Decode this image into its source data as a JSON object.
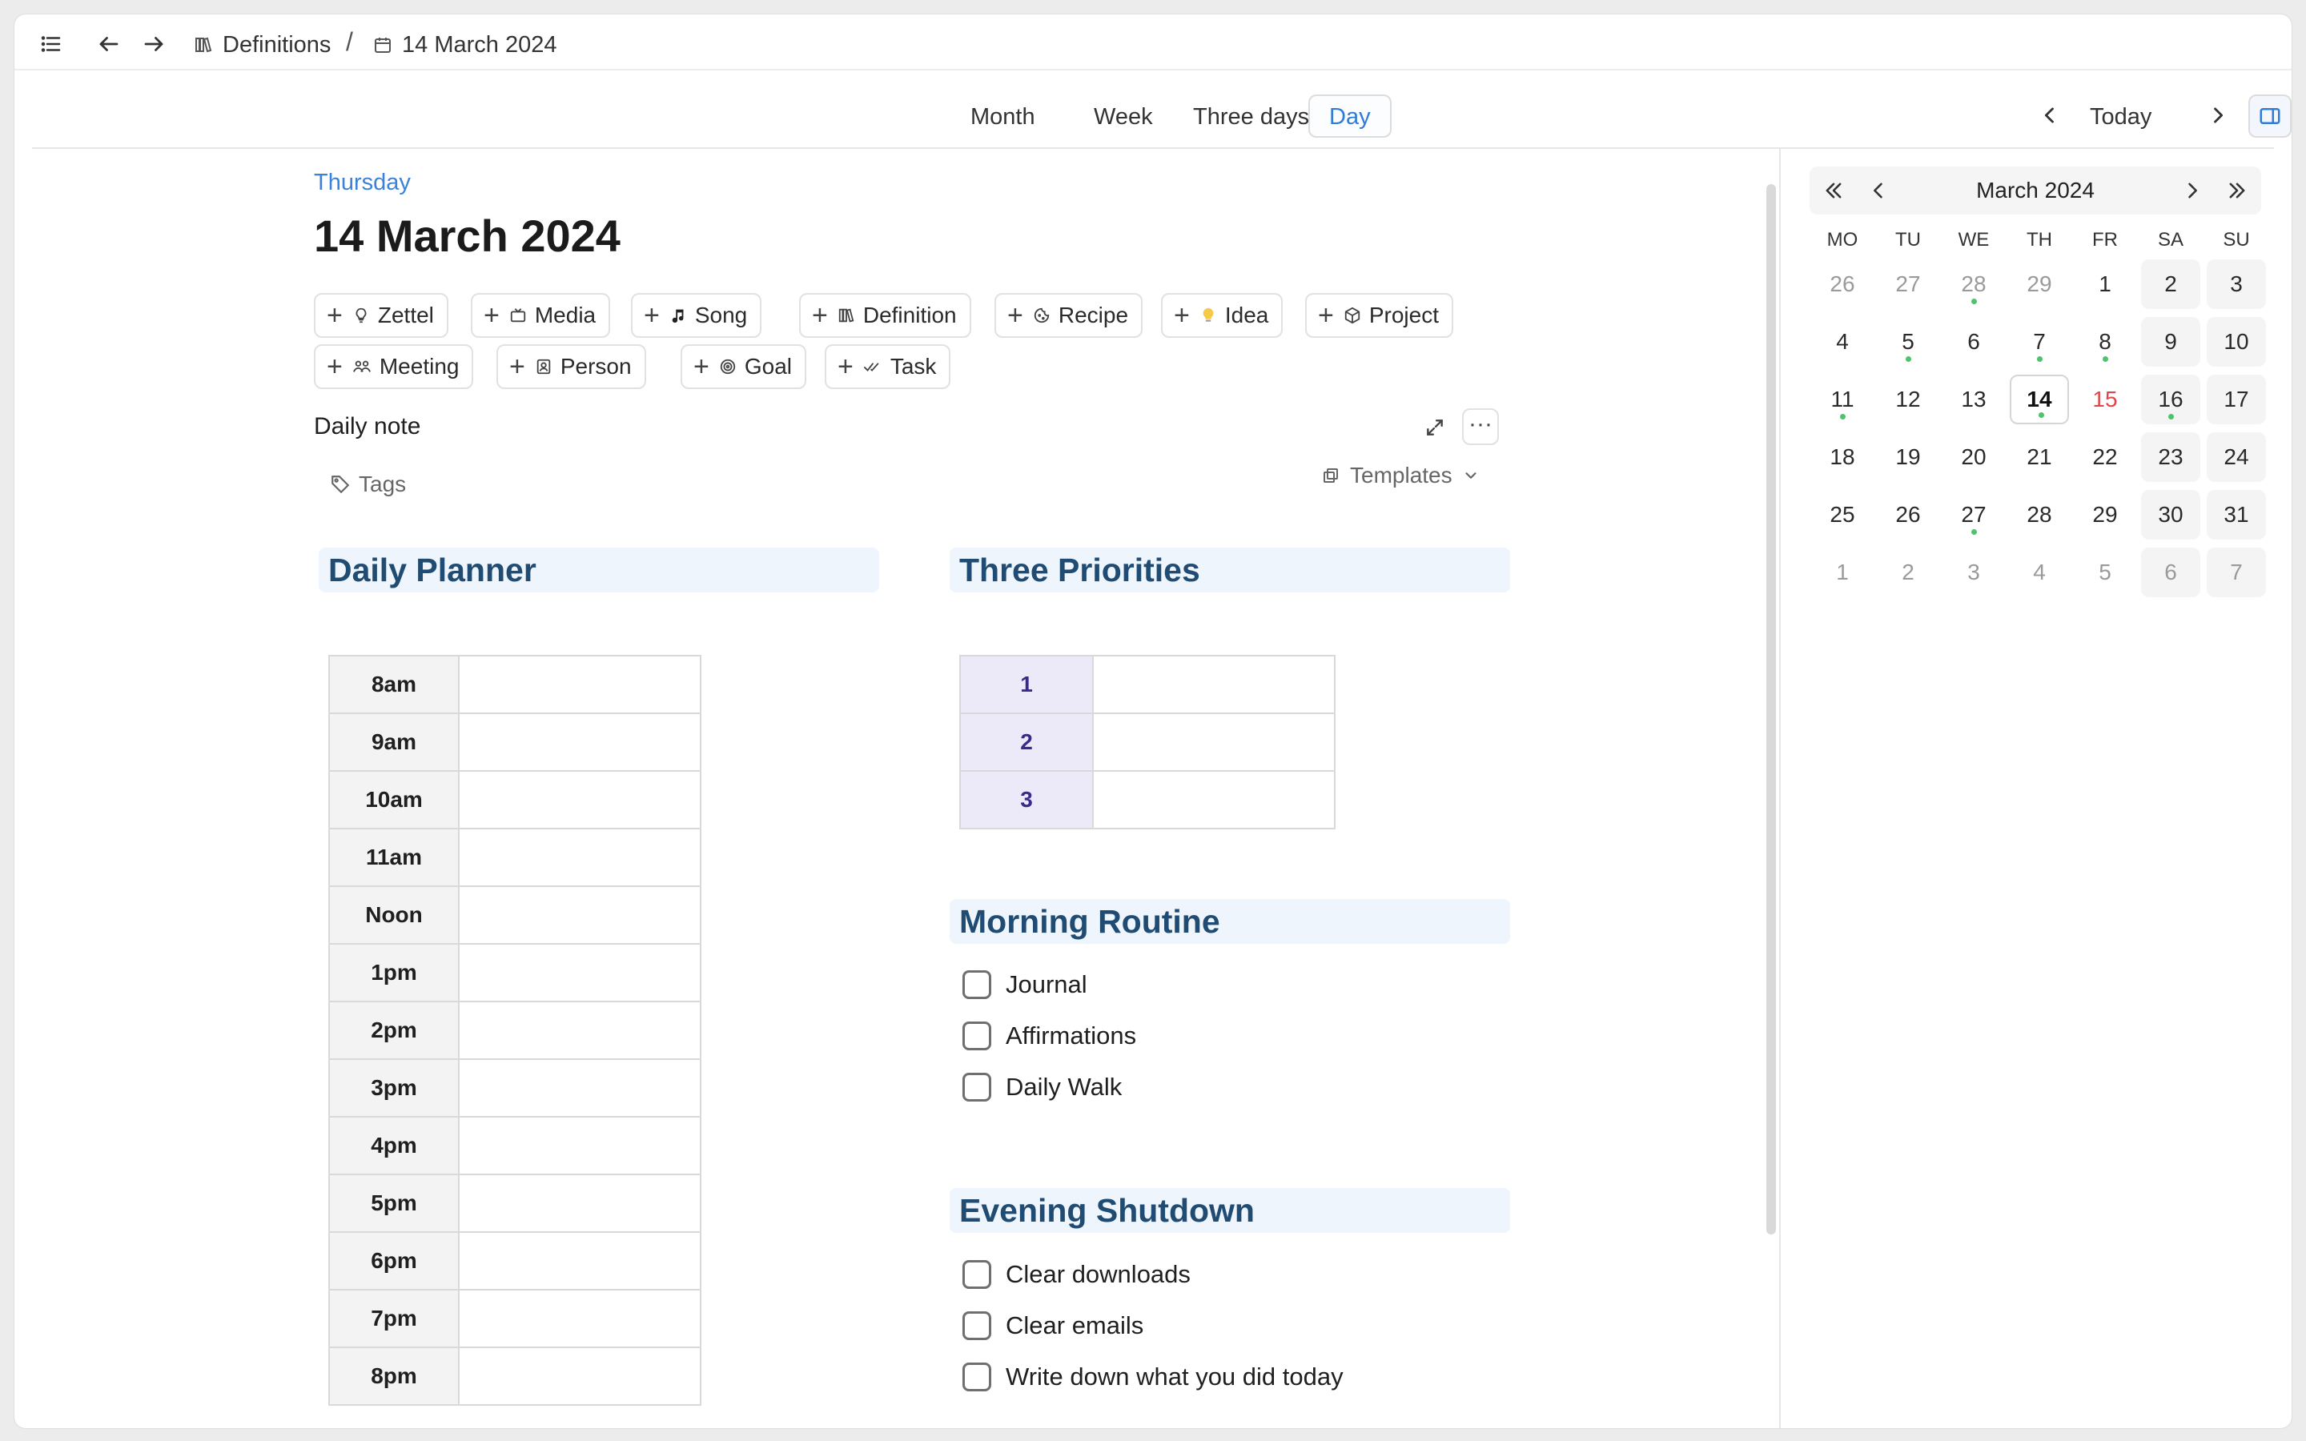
{
  "breadcrumb": {
    "parent": "Definitions",
    "separator": "/",
    "current": "14 March 2024"
  },
  "views": {
    "month": "Month",
    "week": "Week",
    "three_days": "Three days",
    "day": "Day",
    "today": "Today"
  },
  "note": {
    "weekday": "Thursday",
    "title": "14 March 2024"
  },
  "chips": [
    {
      "label": "Zettel",
      "icon": "lightbulb-icon"
    },
    {
      "label": "Media",
      "icon": "tv-icon"
    },
    {
      "label": "Song",
      "icon": "music-note-icon"
    },
    {
      "label": "Definition",
      "icon": "books-icon"
    },
    {
      "label": "Recipe",
      "icon": "cookie-icon"
    },
    {
      "label": "Idea",
      "icon": "bulb-emoji-icon"
    },
    {
      "label": "Project",
      "icon": "cube-icon"
    },
    {
      "label": "Meeting",
      "icon": "people-icon"
    },
    {
      "label": "Person",
      "icon": "contact-icon"
    },
    {
      "label": "Goal",
      "icon": "target-icon"
    },
    {
      "label": "Task",
      "icon": "checks-icon"
    }
  ],
  "daily_note": {
    "label": "Daily note",
    "more": "···",
    "tags": "Tags",
    "templates": "Templates"
  },
  "planner": {
    "title": "Daily Planner",
    "times": [
      "8am",
      "9am",
      "10am",
      "11am",
      "Noon",
      "1pm",
      "2pm",
      "3pm",
      "4pm",
      "5pm",
      "6pm",
      "7pm",
      "8pm"
    ]
  },
  "priorities": {
    "title": "Three Priorities",
    "items": [
      "1",
      "2",
      "3"
    ]
  },
  "morning": {
    "title": "Morning Routine",
    "items": [
      "Journal",
      "Affirmations",
      "Daily Walk"
    ]
  },
  "evening": {
    "title": "Evening Shutdown",
    "items": [
      "Clear downloads",
      "Clear emails",
      "Write down what you did today"
    ]
  },
  "calendar": {
    "month": "March 2024",
    "weekdays": [
      "MO",
      "TU",
      "WE",
      "TH",
      "FR",
      "SA",
      "SU"
    ],
    "weeks": [
      [
        "26",
        "27",
        "28",
        "29",
        "1",
        "2",
        "3"
      ],
      [
        "4",
        "5",
        "6",
        "7",
        "8",
        "9",
        "10"
      ],
      [
        "11",
        "12",
        "13",
        "14",
        "15",
        "16",
        "17"
      ],
      [
        "18",
        "19",
        "20",
        "21",
        "22",
        "23",
        "24"
      ],
      [
        "25",
        "26",
        "27",
        "28",
        "29",
        "30",
        "31"
      ],
      [
        "1",
        "2",
        "3",
        "4",
        "5",
        "6",
        "7"
      ]
    ],
    "today_color": "#e0454b",
    "dot_color": "#4bc46b"
  },
  "colors": {
    "accent": "#2f7bd8",
    "heading": "#204b72",
    "heading_bg": "#eff5fc"
  }
}
